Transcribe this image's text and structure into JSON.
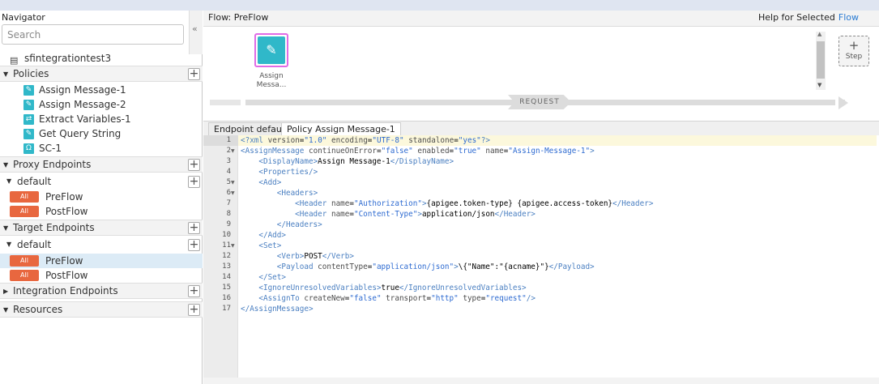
{
  "navigator": {
    "title": "Navigator",
    "search_placeholder": "Search",
    "collapse_glyph": "«",
    "proxy_name": "sfintegrationtest3",
    "sections": {
      "policies": "Policies",
      "proxy_endpoints": "Proxy Endpoints",
      "target_endpoints": "Target Endpoints",
      "integration_endpoints": "Integration Endpoints",
      "resources": "Resources"
    },
    "policies": [
      {
        "label": "Assign Message-1",
        "icon": "pencil-icon"
      },
      {
        "label": "Assign Message-2",
        "icon": "pencil-icon"
      },
      {
        "label": "Extract Variables-1",
        "icon": "extract-icon"
      },
      {
        "label": "Get Query String",
        "icon": "pencil-icon"
      },
      {
        "label": "SC-1",
        "icon": "service-callout-icon"
      }
    ],
    "proxy_default": "default",
    "target_default": "default",
    "badge": "All",
    "proxy_flows": [
      "PreFlow",
      "PostFlow"
    ],
    "target_flows": [
      "PreFlow",
      "PostFlow"
    ],
    "selected_flow": "target-preflow"
  },
  "flow": {
    "title": "Flow: PreFlow",
    "help_label": "Help for Selected",
    "help_link": "Flow",
    "step_name": "Assign Messa...",
    "add_step_label": "Step",
    "request_label": "REQUEST"
  },
  "tabs": [
    {
      "label": "Endpoint default",
      "active": false
    },
    {
      "label": "Policy Assign Message-1",
      "active": true
    }
  ],
  "editor": {
    "line_numbers": [
      "1",
      "2",
      "3",
      "4",
      "5",
      "6",
      "7",
      "8",
      "9",
      "10",
      "11",
      "12",
      "13",
      "14",
      "15",
      "16",
      "17"
    ],
    "active_line": 1,
    "lines": [
      "<?xml version=\"1.0\" encoding=\"UTF-8\" standalone=\"yes\"?>",
      "<AssignMessage continueOnError=\"false\" enabled=\"true\" name=\"Assign-Message-1\">",
      "    <DisplayName>Assign Message-1</DisplayName>",
      "    <Properties/>",
      "    <Add>",
      "        <Headers>",
      "            <Header name=\"Authorization\">{apigee.token-type} {apigee.access-token}</Header>",
      "            <Header name=\"Content-Type\">application/json</Header>",
      "        </Headers>",
      "    </Add>",
      "    <Set>",
      "        <Verb>POST</Verb>",
      "        <Payload contentType=\"application/json\">\\{\"Name\":\"{acname}\"}</Payload>",
      "    </Set>",
      "    <IgnoreUnresolvedVariables>true</IgnoreUnresolvedVariables>",
      "    <AssignTo createNew=\"false\" transport=\"http\" type=\"request\"/>",
      "</AssignMessage>"
    ],
    "foldable_lines": [
      2,
      5,
      6,
      11
    ]
  },
  "colors": {
    "accent_teal": "#30b8c9",
    "badge_orange": "#e8673f",
    "selection_pink": "#e06be6",
    "link_blue": "#2a7bd3"
  }
}
